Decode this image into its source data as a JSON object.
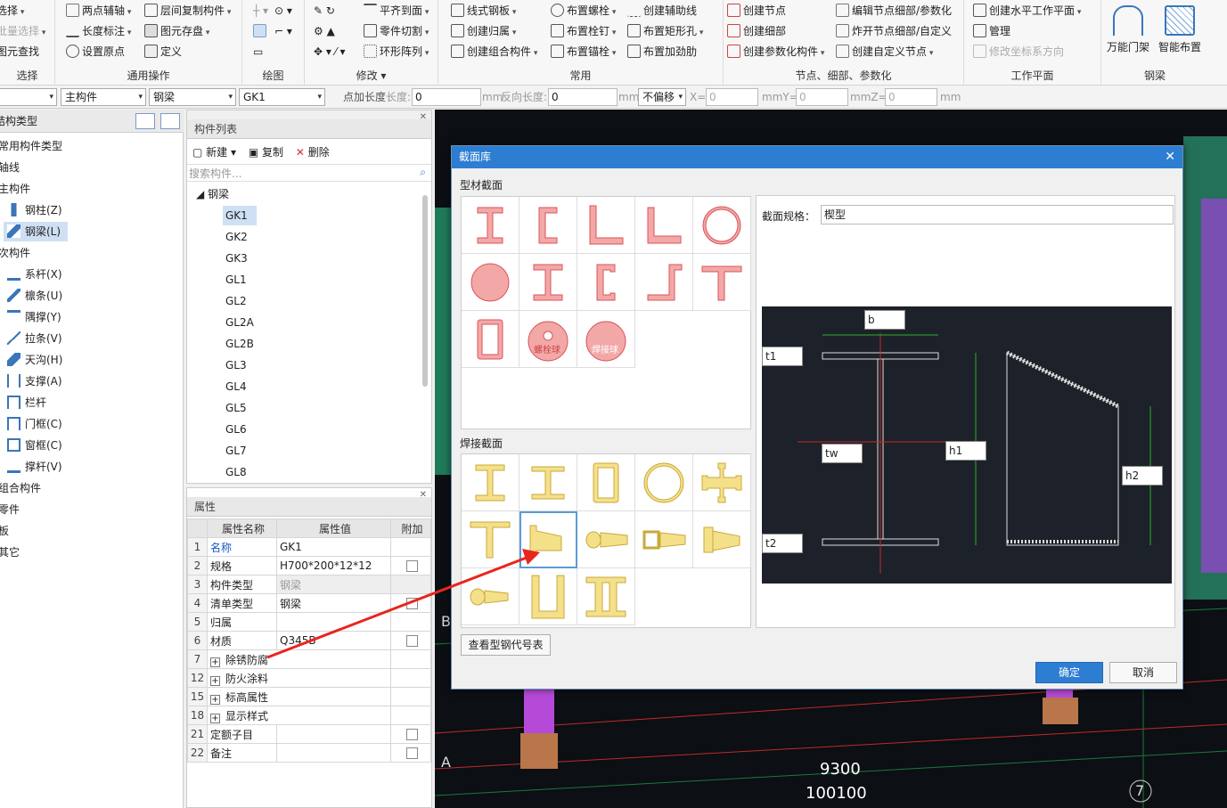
{
  "ribbon": {
    "groups": [
      "选择",
      "通用操作",
      "绘图",
      "修改",
      "常用",
      "节点、细部、参数化",
      "工作平面",
      "钢梁"
    ],
    "select": [
      "选择",
      "批量选择",
      "图元查找"
    ],
    "general": [
      "两点辅轴",
      "长度标注",
      "设置原点",
      "层间复制构件",
      "图元存盘",
      "定义"
    ],
    "modify": [
      "平齐到面",
      "零件切割",
      "环形阵列"
    ],
    "common": [
      "线式钢板",
      "创建归属",
      "创建组合构件",
      "布置螺栓",
      "布置栓钉",
      "布置锚栓",
      "创建辅助线",
      "布置矩形孔",
      "布置加劲肋"
    ],
    "node": [
      "创建节点",
      "创建细部",
      "创建参数化构件",
      "编辑节点细部/参数化",
      "炸开节点细部/自定义",
      "创建自定义节点"
    ],
    "plane": [
      "创建水平工作平面",
      "管理",
      "修改坐标系方向"
    ],
    "steel": [
      "万能门架",
      "智能布置"
    ]
  },
  "toolbar": {
    "cat": "主构件",
    "type": "钢梁",
    "name": "GK1",
    "add_len": "点加长度",
    "len_lbl": "长度:",
    "len_val": "0",
    "mm1": "mm",
    "rev_lbl": "反向长度:",
    "rev_val": "0",
    "mm2": "mm",
    "offset": "不偏移",
    "x_lbl": "X=",
    "x_val": "0",
    "y_lbl": "mmY=",
    "y_val": "0",
    "z_lbl": "mmZ=",
    "z_val": "0",
    "mm3": "mm"
  },
  "left_panel": {
    "title": "结构类型",
    "items": [
      "常用构件类型",
      "轴线",
      "主构件",
      "钢柱(Z)",
      "钢梁(L)",
      "次构件",
      "系杆(X)",
      "檩条(U)",
      "隅撑(Y)",
      "拉条(V)",
      "天沟(H)",
      "支撑(A)",
      "栏杆",
      "门框(C)",
      "窗框(C)",
      "撑杆(V)",
      "组合构件",
      "零件",
      "板",
      "其它"
    ]
  },
  "comp_list": {
    "title": "构件列表",
    "new": "新建",
    "copy": "复制",
    "del": "删除",
    "search_ph": "搜索构件...",
    "group": "钢梁",
    "items": [
      "GK1",
      "GK2",
      "GK3",
      "GL1",
      "GL2",
      "GL2A",
      "GL2B",
      "GL3",
      "GL4",
      "GL5",
      "GL6",
      "GL7",
      "GL8"
    ]
  },
  "props": {
    "title": "属性",
    "col_name": "属性名称",
    "col_val": "属性值",
    "col_add": "附加",
    "rows": [
      {
        "n": "1",
        "k": "名称",
        "v": "GK1"
      },
      {
        "n": "2",
        "k": "规格",
        "v": "H700*200*12*12"
      },
      {
        "n": "3",
        "k": "构件类型",
        "v": "钢梁"
      },
      {
        "n": "4",
        "k": "清单类型",
        "v": "钢梁"
      },
      {
        "n": "5",
        "k": "归属",
        "v": ""
      },
      {
        "n": "6",
        "k": "材质",
        "v": "Q345B"
      },
      {
        "n": "7",
        "k": "除锈防腐",
        "v": ""
      },
      {
        "n": "12",
        "k": "防火涂料",
        "v": ""
      },
      {
        "n": "15",
        "k": "标高属性",
        "v": ""
      },
      {
        "n": "18",
        "k": "显示样式",
        "v": ""
      },
      {
        "n": "21",
        "k": "定额子目",
        "v": ""
      },
      {
        "n": "22",
        "k": "备注",
        "v": ""
      }
    ]
  },
  "viewport": {
    "axis_a": "A",
    "axis_b": "B",
    "axis_7": "7",
    "dim1": "9300",
    "dim2": "100100"
  },
  "dialog": {
    "title": "截面库",
    "sec1": "型材截面",
    "sec2": "焊接截面",
    "spec_lbl": "截面规格：",
    "spec_val": "楔型",
    "bolt_ball": "螺栓球",
    "weld_ball": "焊接球",
    "view_code": "查看型钢代号表",
    "ok": "确定",
    "cancel": "取消",
    "dims": {
      "b": "b",
      "t1": "t1",
      "tw": "tw",
      "h1": "h1",
      "h2": "h2",
      "t2": "t2"
    }
  }
}
